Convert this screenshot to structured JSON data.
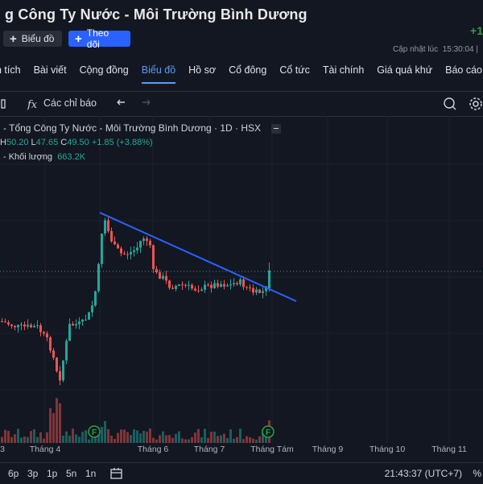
{
  "header": {
    "title": "g Công Ty Nước - Môi Trường Bình Dương",
    "change": "+1",
    "chart_button": "Biểu đồ",
    "follow_button": "Theo dõi",
    "updated_label": "Cập nhật lúc",
    "updated_time": "15:30:04 |"
  },
  "tabs": [
    {
      "label": "n tích"
    },
    {
      "label": "Bài viết"
    },
    {
      "label": "Cộng đồng"
    },
    {
      "label": "Biểu đồ",
      "active": true
    },
    {
      "label": "Hồ sơ"
    },
    {
      "label": "Cổ đông"
    },
    {
      "label": "Cổ tức"
    },
    {
      "label": "Tài chính"
    },
    {
      "label": "Giá quá khứ"
    },
    {
      "label": "Báo cáo"
    }
  ],
  "toolbar": {
    "indicators_label": "Các chỉ báo",
    "fx_icon": "fx-icon",
    "undo_icon": "undo-icon",
    "redo_icon": "redo-icon",
    "camera_icon": "snapshot-icon",
    "settings_icon": "gear-icon"
  },
  "legend": {
    "symbol": "- Tổng Công Ty Nước - Môi Trường Bình Dương · 1D · HSX",
    "h_label": "H",
    "h_value": "50.20",
    "l_label": "L",
    "l_value": "47.65",
    "c_label": "C",
    "c_value": "49.50",
    "change": "+1.85 (+3.88%)",
    "volume_label": "- Khối lượng",
    "volume_value": "663.2K"
  },
  "chart_data": {
    "type": "candlestick",
    "x_labels": [
      "3",
      "Tháng 4",
      "Tháng 6",
      "Tháng 7",
      "Tháng Tám",
      "Tháng 9",
      "Tháng 10",
      "Tháng 11"
    ],
    "last_close": 49.5,
    "high": 50.2,
    "low": 47.65,
    "trendline": "descending",
    "event_markers": [
      "F",
      "F"
    ],
    "colors": {
      "up": "#26a69a",
      "down": "#ef5350",
      "trendline": "#2962ff",
      "background": "#131722"
    }
  },
  "footer": {
    "ranges": [
      "6p",
      "3p",
      "1p",
      "5n",
      "1n"
    ],
    "clock": "21:43:37 (UTC+7)",
    "pct": "%"
  }
}
